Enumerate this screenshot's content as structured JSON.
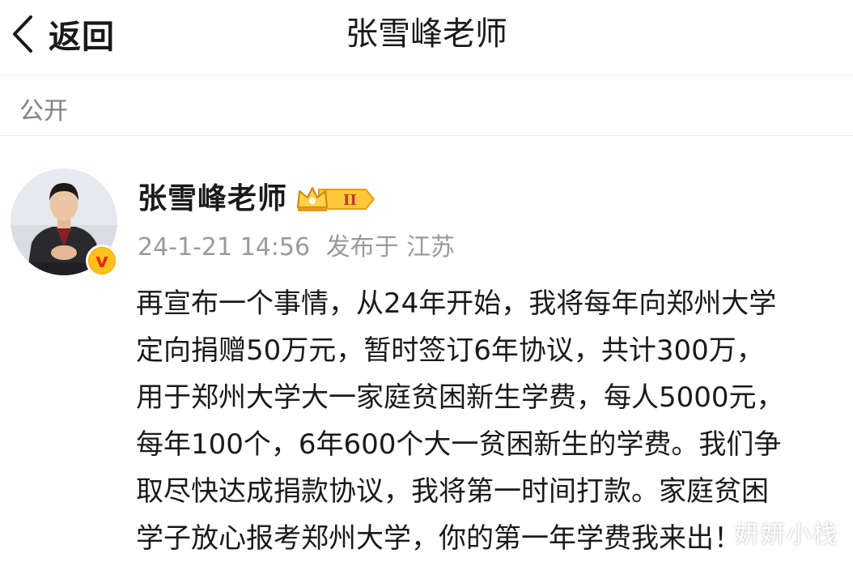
{
  "nav": {
    "back_label": "返回",
    "title": "张雪峰老师"
  },
  "visibility": "公开",
  "post": {
    "author": "张雪峰老师",
    "member_badge_text": "II",
    "verified_text": "v",
    "time": "24-1-21 14:56",
    "location": "发布于 江苏",
    "lines": [
      "再宣布一个事情，从24年开始，我将每年向郑州大学",
      "定向捐赠50万元，暂时签订6年协议，共计300万，",
      "用于郑州大学大一家庭贫困新生学费，每人5000元，",
      "每年100个，6年600个大一贫困新生的学费。我们争",
      "取尽快达成捐款协议，我将第一时间打款。家庭贫困",
      "学子放心报考郑州大学，你的第一年学费我来出！"
    ]
  },
  "watermark": "妍妍小栈",
  "colors": {
    "text": "#1a1a1a",
    "muted": "#808080",
    "meta": "#9a9a9a",
    "badge_gold": "#f5a30c",
    "verified_red": "#e8261a",
    "divider": "#ececec"
  }
}
